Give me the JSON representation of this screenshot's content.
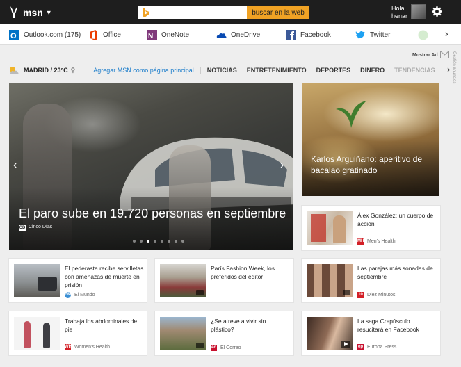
{
  "topbar": {
    "brand": "msn",
    "search_placeholder": "",
    "search_button": "buscar en la web",
    "greeting_line1": "Hola",
    "greeting_line2": "henar"
  },
  "shortcuts": [
    {
      "label": "Outlook.com",
      "count": "(175)",
      "icon": "outlook-icon",
      "color": "#0072c6"
    },
    {
      "label": "Office",
      "icon": "office-icon",
      "color": "#eb3c00"
    },
    {
      "label": "OneNote",
      "icon": "onenote-icon",
      "color": "#80397b"
    },
    {
      "label": "OneDrive",
      "icon": "onedrive-icon",
      "color": "#094ab2"
    },
    {
      "label": "Facebook",
      "icon": "facebook-icon",
      "color": "#3b5998"
    },
    {
      "label": "Twitter",
      "icon": "twitter-icon",
      "color": "#1da1f2"
    }
  ],
  "ad": {
    "show_label": "Mostrar Ad",
    "side_label": "Gestión anuncios"
  },
  "nav": {
    "city": "MADRID / 23°C",
    "set_home": "Agregar MSN como página principal",
    "categories": [
      "NOTICIAS",
      "ENTRETENIMIENTO",
      "DEPORTES",
      "DINERO",
      "TENDENCIAS"
    ]
  },
  "hero": {
    "title": "El paro sube en 19.720 personas en septiembre",
    "source": "Cinco Días",
    "source_icon_text": "CD",
    "slide_count": 8,
    "active_slide": 2
  },
  "feature": {
    "title": "Karlos Arguiñano: aperitivo de bacalao gratinado"
  },
  "cards": [
    {
      "title": "Álex González: un cuerpo de acción",
      "source": "Men's Health",
      "source_icon": "MH",
      "source_color": "#d32027"
    },
    {
      "title": "El pederasta recibe servilletas con amenazas de muerte en prisión",
      "source": "El Mundo",
      "source_icon": "EM",
      "source_color": "#3b8fd4"
    },
    {
      "title": "París Fashion Week, los preferidos del editor",
      "source": "",
      "source_icon": "",
      "source_color": ""
    },
    {
      "title": "Las parejas más sonadas de septiembre",
      "source": "Diez Minutos",
      "source_icon": "10",
      "source_color": "#d32027"
    },
    {
      "title": "Trabaja los abdominales de pie",
      "source": "Women's Health",
      "source_icon": "WH",
      "source_color": "#d32027"
    },
    {
      "title": "¿Se atreve a vivir sin plástico?",
      "source": "El Correo",
      "source_icon": "ec",
      "source_color": "#c8102e"
    },
    {
      "title": "La saga Crepúsculo resucitará en Facebook",
      "source": "Europa Press",
      "source_icon": "ep",
      "source_color": "#c8102e"
    }
  ]
}
